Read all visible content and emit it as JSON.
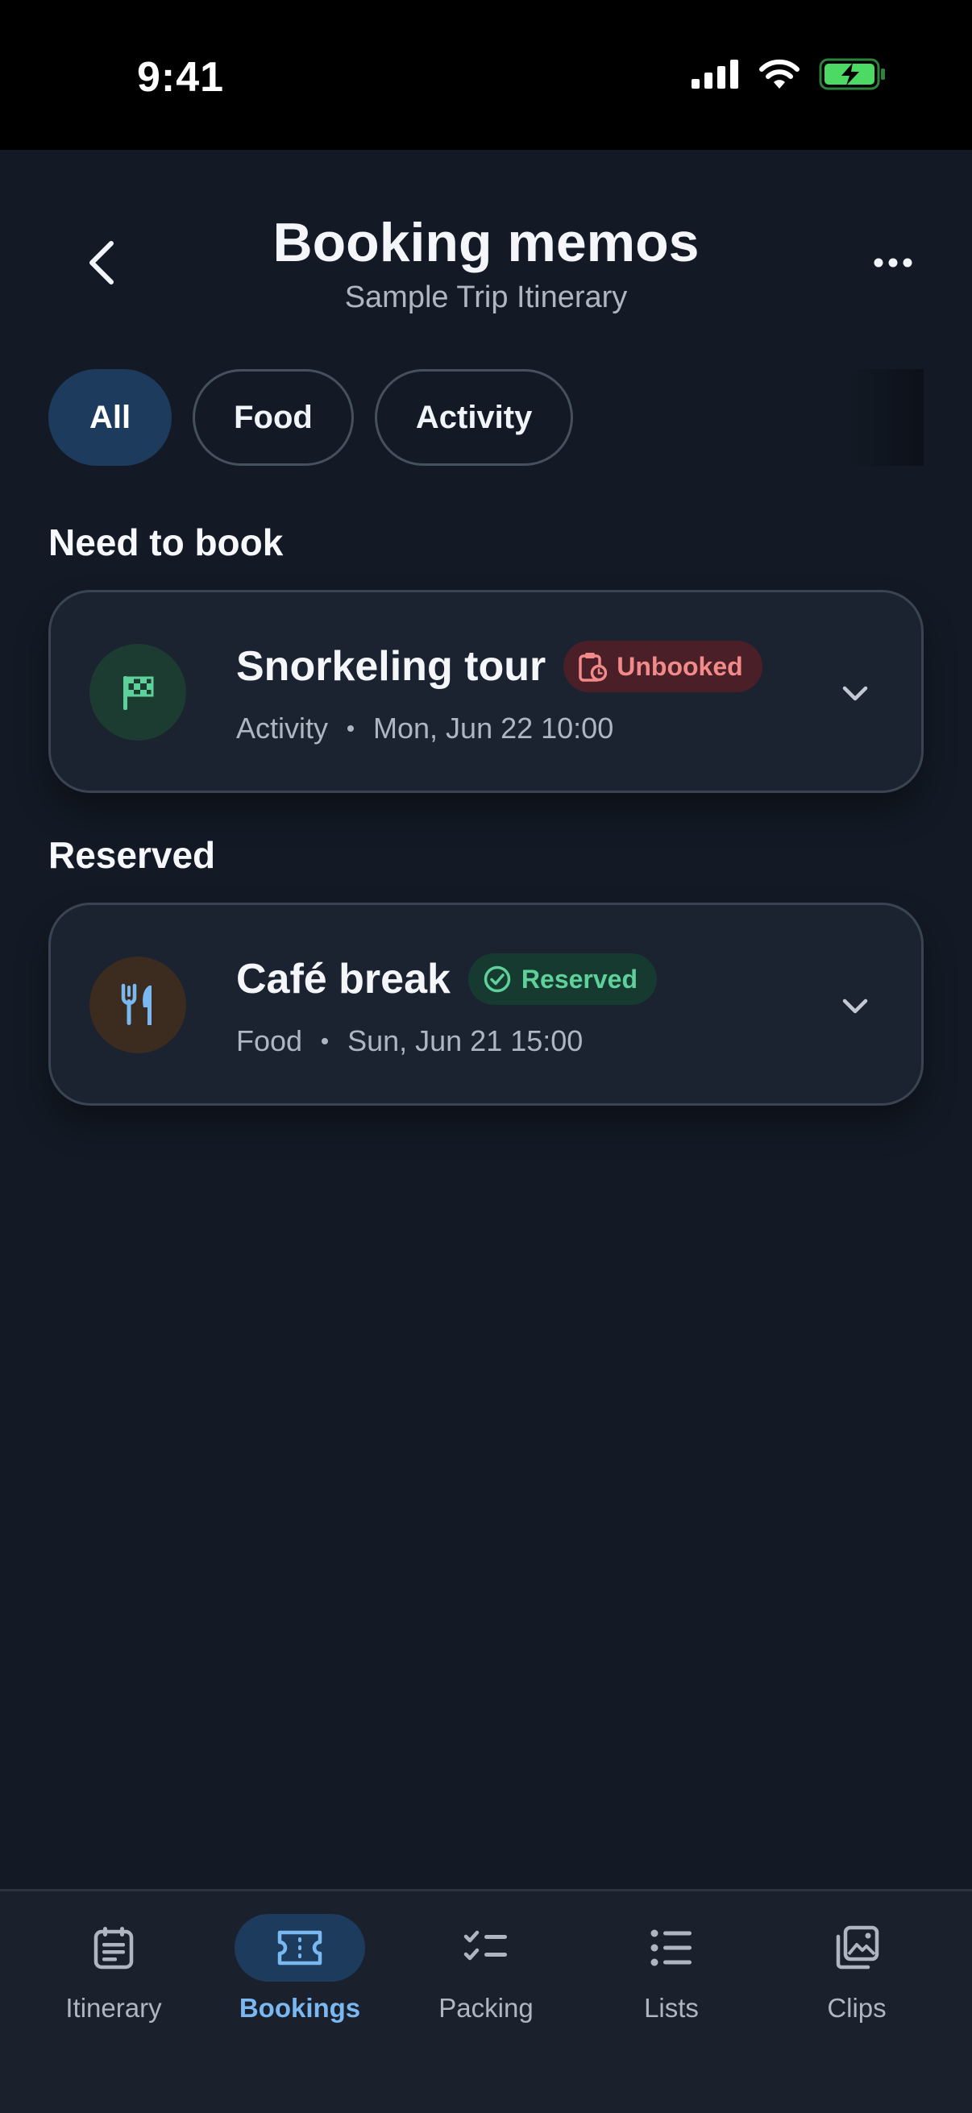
{
  "status_bar": {
    "time": "9:41"
  },
  "header": {
    "title": "Booking memos",
    "subtitle": "Sample Trip Itinerary"
  },
  "filters": [
    {
      "label": "All",
      "active": true
    },
    {
      "label": "Food",
      "active": false
    },
    {
      "label": "Activity",
      "active": false
    }
  ],
  "sections": {
    "need_to_book": {
      "title": "Need to book",
      "item": {
        "title": "Snorkeling tour",
        "icon": "flag-icon",
        "badge": "Unbooked",
        "category": "Activity",
        "datetime": "Mon, Jun 22 10:00"
      }
    },
    "reserved": {
      "title": "Reserved",
      "item": {
        "title": "Café break",
        "icon": "fork-knife-icon",
        "badge": "Reserved",
        "category": "Food",
        "datetime": "Sun, Jun 21 15:00"
      }
    }
  },
  "tabs": [
    {
      "label": "Itinerary",
      "icon": "calendar-icon"
    },
    {
      "label": "Bookings",
      "icon": "ticket-icon",
      "active": true
    },
    {
      "label": "Packing",
      "icon": "checklist-icon"
    },
    {
      "label": "Lists",
      "icon": "list-icon"
    },
    {
      "label": "Clips",
      "icon": "gallery-icon"
    }
  ],
  "colors": {
    "background": "#131a25",
    "accent": "#7ab8f2",
    "unbooked": "#f28a8a",
    "reserved": "#5ed19a"
  }
}
